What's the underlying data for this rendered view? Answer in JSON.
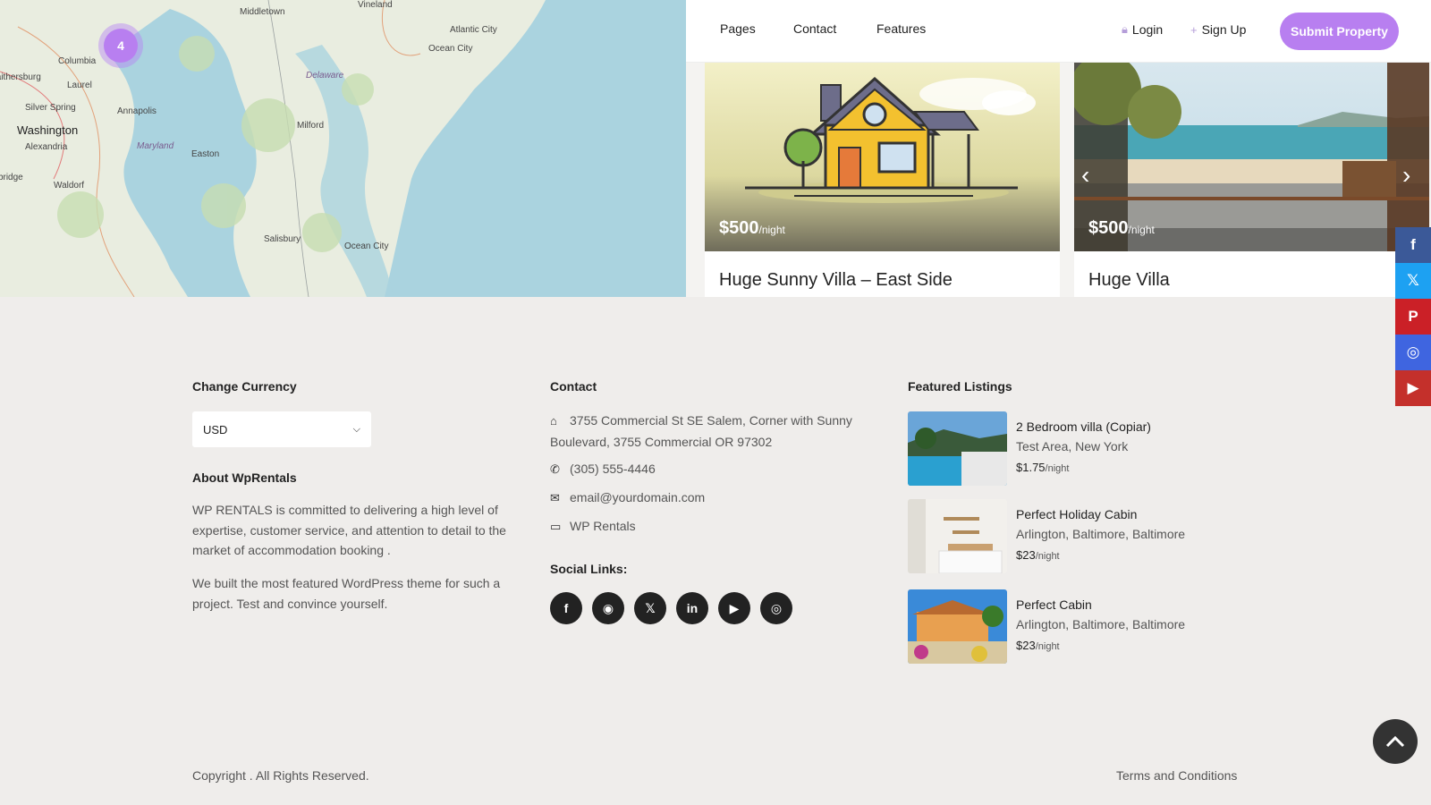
{
  "map": {
    "cluster_count": "4",
    "labels": {
      "middletown": "Middletown",
      "vineland": "Vineland",
      "atlantic_city": "Atlantic City",
      "ocean_city_nj": "Ocean City",
      "columbia": "Columbia",
      "gaithersburg": "Gaithersburg",
      "laurel": "Laurel",
      "silver_spring": "Silver Spring",
      "annapolis": "Annapolis",
      "washington": "Washington",
      "alexandria": "Alexandria",
      "delaware": "Delaware",
      "milford": "Milford",
      "maryland": "Maryland",
      "easton": "Easton",
      "woodbridge": "Woodbridge",
      "waldorf": "Waldorf",
      "salisbury": "Salisbury",
      "ocean_city_md": "Ocean City"
    }
  },
  "header": {
    "nav": [
      "Pages",
      "Contact",
      "Features"
    ],
    "login": "Login",
    "signup": "Sign Up",
    "submit": "Submit Property"
  },
  "cards": [
    {
      "price": "$500",
      "unit": "/night",
      "title": "Huge Sunny Villa – East Side"
    },
    {
      "price": "$500",
      "unit": "/night",
      "title": "Huge Villa"
    }
  ],
  "footer": {
    "currency_title": "Change Currency",
    "currency_value": "USD",
    "about_title": "About WpRentals",
    "about_p1": "WP RENTALS is committed to delivering a high level of expertise, customer service, and attention to detail to the market of accommodation booking .",
    "about_p2": "We built the most featured WordPress theme for such a project. Test and convince yourself.",
    "contact_title": "Contact",
    "address": "3755 Commercial St SE Salem, Corner with Sunny Boulevard, 3755 Commercial OR 97302",
    "phone": "(305) 555-4446",
    "email": "email@yourdomain.com",
    "website": "WP Rentals",
    "social_title": "Social Links:",
    "featured_title": "Featured Listings",
    "featured": [
      {
        "title": "2 Bedroom villa (Copiar)",
        "location": "Test Area, New York",
        "price": "$1.75",
        "unit": "/night"
      },
      {
        "title": "Perfect Holiday Cabin",
        "location": "Arlington, Baltimore, Baltimore",
        "price": "$23",
        "unit": "/night"
      },
      {
        "title": "Perfect Cabin",
        "location": "Arlington, Baltimore, Baltimore",
        "price": "$23",
        "unit": "/night"
      }
    ],
    "copyright": "Copyright . All Rights Reserved.",
    "terms": "Terms and Conditions"
  },
  "colors": {
    "accent": "#b87ff0",
    "facebook": "#3b5998",
    "x": "#1da1f2",
    "pinterest": "#cb2027",
    "instagram": "#3f65e0",
    "youtube": "#c4302b"
  }
}
